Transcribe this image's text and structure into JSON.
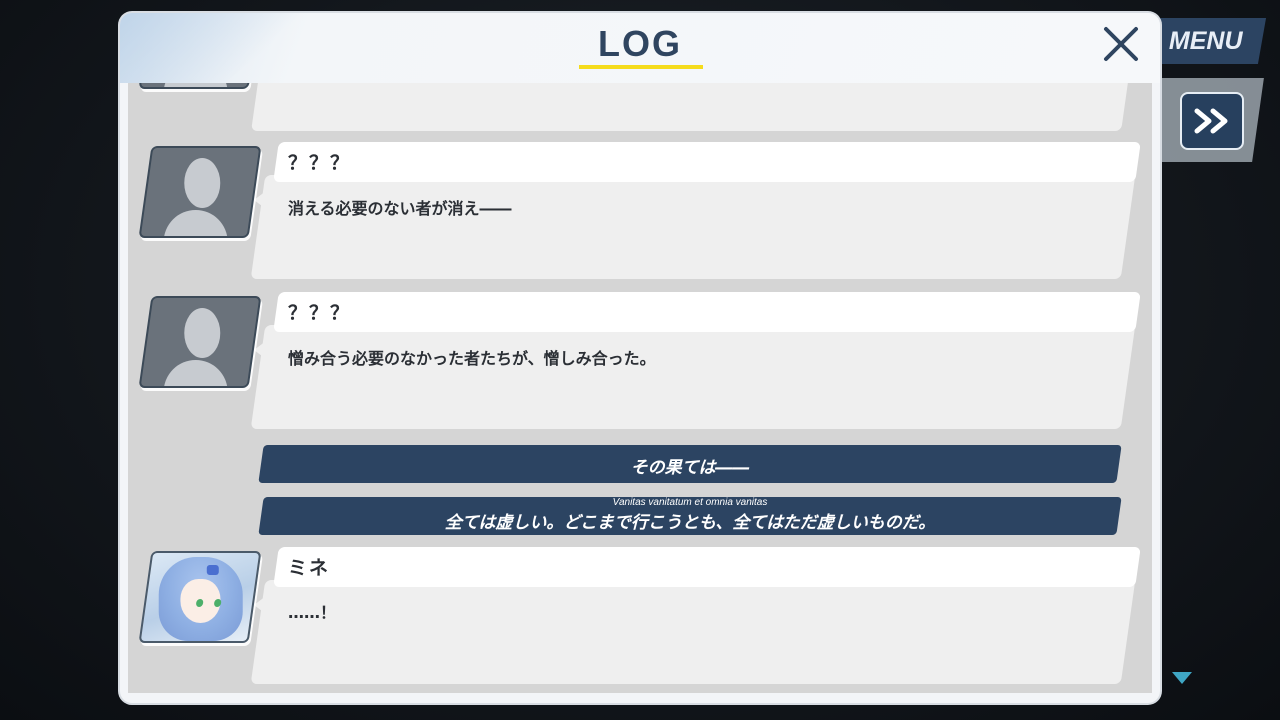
{
  "background": {
    "menu_label": "MENU",
    "skip_icon": "fast-forward-icon",
    "scroll_indicator_icon": "triangle-down-icon"
  },
  "log": {
    "title": "LOG",
    "close_icon": "close-x-icon",
    "accent_color": "#f5dc1c",
    "banner_color": "#2c4462",
    "entries": [
      {
        "speaker": "？？？",
        "text": "消える必要のない者が消え――"
      },
      {
        "speaker": "？？？",
        "text": "憎み合う必要のなかった者たちが、憎しみ合った。"
      }
    ],
    "banners": [
      {
        "text": "その果ては――"
      },
      {
        "ruby": "Vanitas vanitatum et omnia vanitas",
        "text": "全ては虚しい。どこまで行こうとも、全てはただ虚しいものだ。"
      }
    ],
    "final_entry": {
      "speaker": "ミネ",
      "text": "……！"
    }
  }
}
